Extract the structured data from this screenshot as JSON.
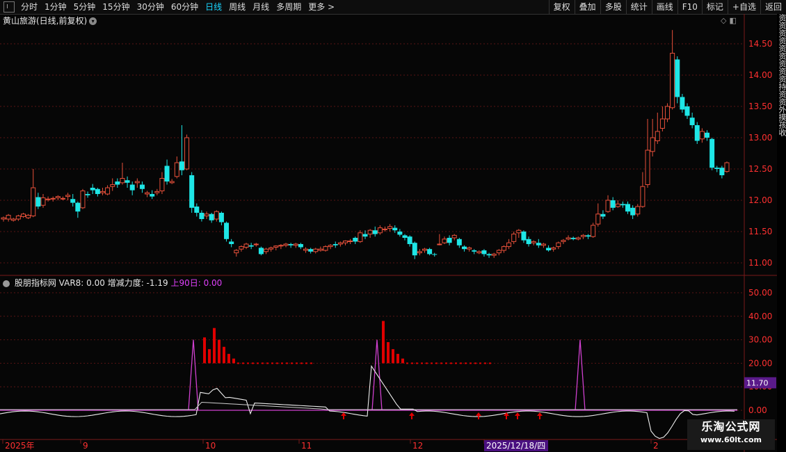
{
  "toolbar": {
    "periods": [
      "分时",
      "1分钟",
      "5分钟",
      "15分钟",
      "30分钟",
      "60分钟",
      "日线",
      "周线",
      "月线",
      "多周期",
      "更多 >"
    ],
    "active_period": "日线",
    "actions": [
      "复权",
      "叠加",
      "多股",
      "统计",
      "画线",
      "F10",
      "标记",
      "+自选",
      "返回"
    ]
  },
  "main_chart": {
    "title": "黄山旅游(日线,前复权)",
    "title_icon": "chevron-down-icon"
  },
  "indicator": {
    "title": "股朋指标网",
    "var8": "VAR8: 0.00",
    "force": "增减力度: -1.19",
    "up90": "上90日: 0.00",
    "current_value_label": "11.70"
  },
  "x_axis": {
    "labels": [
      "2025年",
      "9",
      "10",
      "11",
      "12",
      "2025/12/18/四",
      "2"
    ]
  },
  "side_strip": [
    "资",
    "资",
    "资",
    "资",
    "资",
    "资",
    "资",
    "资",
    "资",
    "持",
    "资",
    "资",
    "外",
    "摸",
    "孩",
    "收"
  ],
  "watermark": {
    "main": "乐淘公式网",
    "url": "www.60lt.com"
  },
  "colors": {
    "up": "#e8503a",
    "down": "#1ee6e6",
    "magenta": "#d040d0",
    "signal": "#e00000",
    "grid": "#5a1414",
    "axis": "#ff3030"
  },
  "chart_data": {
    "type": "candlestick",
    "title": "黄山旅游(日线,前复权)",
    "y_ticks": [
      "14.50",
      "14.00",
      "13.50",
      "13.00",
      "12.50",
      "12.00",
      "11.50",
      "11.00"
    ],
    "ylim": [
      10.88,
      14.8
    ],
    "indicator_ticks": [
      "50.00",
      "40.00",
      "30.00",
      "20.00",
      "10.00",
      "0.00"
    ],
    "indicator_ylim": [
      -10,
      56
    ],
    "candles": [
      [
        11.7,
        11.72,
        11.66,
        11.74
      ],
      [
        11.7,
        11.76,
        11.66,
        11.78
      ],
      [
        11.68,
        11.7,
        11.66,
        11.72
      ],
      [
        11.7,
        11.75,
        11.67,
        11.77
      ],
      [
        11.74,
        11.78,
        11.72,
        11.8
      ],
      [
        11.72,
        11.76,
        11.7,
        11.78
      ],
      [
        11.75,
        12.2,
        11.73,
        12.5
      ],
      [
        12.05,
        11.9,
        11.86,
        12.12
      ],
      [
        11.92,
        12.04,
        11.88,
        12.1
      ],
      [
        12.02,
        12.02,
        11.98,
        12.06
      ],
      [
        12.02,
        12.03,
        11.98,
        12.06
      ],
      [
        12.04,
        12.06,
        12.0,
        12.08
      ],
      [
        12.03,
        12.03,
        12.0,
        12.06
      ],
      [
        12.06,
        12.08,
        12.0,
        12.12
      ],
      [
        12.02,
        11.96,
        11.9,
        12.1
      ],
      [
        11.96,
        11.82,
        11.72,
        11.98
      ],
      [
        11.88,
        12.15,
        11.86,
        12.18
      ],
      [
        12.1,
        12.08,
        12.04,
        12.14
      ],
      [
        12.2,
        12.16,
        12.1,
        12.26
      ],
      [
        12.18,
        12.1,
        12.06,
        12.2
      ],
      [
        12.12,
        12.14,
        12.08,
        12.2
      ],
      [
        12.1,
        12.2,
        12.08,
        12.24
      ],
      [
        12.22,
        12.25,
        12.15,
        12.35
      ],
      [
        12.3,
        12.25,
        12.2,
        12.35
      ],
      [
        12.28,
        12.35,
        12.25,
        12.6
      ],
      [
        12.32,
        12.28,
        12.2,
        12.38
      ],
      [
        12.25,
        12.16,
        12.08,
        12.3
      ],
      [
        12.28,
        12.3,
        12.2,
        12.35
      ],
      [
        12.25,
        12.18,
        12.12,
        12.3
      ],
      [
        12.1,
        12.12,
        12.05,
        12.15
      ],
      [
        12.1,
        12.06,
        12.02,
        12.16
      ],
      [
        12.12,
        12.14,
        12.08,
        12.18
      ],
      [
        12.15,
        12.35,
        12.1,
        12.45
      ],
      [
        12.55,
        12.3,
        12.25,
        12.65
      ],
      [
        12.28,
        12.3,
        12.26,
        12.34
      ],
      [
        12.38,
        12.6,
        12.35,
        12.7
      ],
      [
        12.62,
        12.48,
        12.4,
        13.2
      ],
      [
        12.5,
        13.0,
        12.48,
        13.05
      ],
      [
        12.4,
        11.88,
        11.8,
        12.45
      ],
      [
        11.9,
        11.8,
        11.74,
        11.95
      ],
      [
        11.8,
        11.7,
        11.66,
        11.84
      ],
      [
        11.75,
        11.78,
        11.7,
        11.82
      ],
      [
        11.78,
        11.68,
        11.64,
        11.8
      ],
      [
        11.7,
        11.82,
        11.66,
        11.84
      ],
      [
        11.8,
        11.65,
        11.6,
        11.82
      ],
      [
        11.64,
        11.38,
        11.34,
        11.66
      ],
      [
        11.34,
        11.3,
        11.25,
        11.38
      ],
      [
        11.16,
        11.2,
        11.1,
        11.22
      ],
      [
        11.22,
        11.26,
        11.18,
        11.28
      ],
      [
        11.25,
        11.3,
        11.22,
        11.32
      ],
      [
        11.28,
        11.26,
        11.22,
        11.32
      ],
      [
        11.3,
        11.3,
        11.26,
        11.32
      ],
      [
        11.24,
        11.14,
        11.12,
        11.26
      ],
      [
        11.18,
        11.22,
        11.14,
        11.24
      ],
      [
        11.22,
        11.24,
        11.18,
        11.26
      ],
      [
        11.25,
        11.27,
        11.2,
        11.28
      ],
      [
        11.27,
        11.28,
        11.22,
        11.3
      ],
      [
        11.28,
        11.3,
        11.25,
        11.32
      ],
      [
        11.3,
        11.28,
        11.24,
        11.32
      ],
      [
        11.28,
        11.3,
        11.24,
        11.32
      ],
      [
        11.3,
        11.25,
        11.22,
        11.32
      ],
      [
        11.2,
        11.22,
        11.16,
        11.25
      ],
      [
        11.22,
        11.18,
        11.15,
        11.24
      ],
      [
        11.18,
        11.22,
        11.15,
        11.24
      ],
      [
        11.2,
        11.22,
        11.18,
        11.26
      ],
      [
        11.2,
        11.26,
        11.18,
        11.28
      ],
      [
        11.26,
        11.28,
        11.22,
        11.3
      ],
      [
        11.3,
        11.28,
        11.24,
        11.34
      ],
      [
        11.3,
        11.32,
        11.26,
        11.34
      ],
      [
        11.32,
        11.35,
        11.28,
        11.36
      ],
      [
        11.35,
        11.35,
        11.3,
        11.38
      ],
      [
        11.4,
        11.34,
        11.3,
        11.42
      ],
      [
        11.34,
        11.48,
        11.32,
        11.52
      ],
      [
        11.46,
        11.42,
        11.38,
        11.52
      ],
      [
        11.46,
        11.52,
        11.4,
        11.54
      ],
      [
        11.52,
        11.46,
        11.42,
        11.58
      ],
      [
        11.48,
        11.56,
        11.45,
        11.6
      ],
      [
        11.54,
        11.54,
        11.5,
        11.58
      ],
      [
        11.55,
        11.58,
        11.5,
        11.62
      ],
      [
        11.56,
        11.52,
        11.48,
        11.6
      ],
      [
        11.5,
        11.45,
        11.42,
        11.54
      ],
      [
        11.44,
        11.4,
        11.36,
        11.46
      ],
      [
        11.42,
        11.3,
        11.26,
        11.44
      ],
      [
        11.32,
        11.12,
        11.06,
        11.34
      ],
      [
        11.16,
        11.18,
        11.12,
        11.22
      ],
      [
        11.2,
        11.22,
        11.16,
        11.24
      ],
      [
        11.22,
        11.14,
        11.12,
        11.24
      ],
      [
        11.14,
        11.13,
        11.1,
        11.16
      ],
      [
        11.3,
        11.3,
        11.28,
        11.46
      ],
      [
        11.32,
        11.38,
        11.3,
        11.42
      ],
      [
        11.4,
        11.32,
        11.28,
        11.44
      ],
      [
        11.4,
        11.44,
        11.36,
        11.46
      ],
      [
        11.38,
        11.28,
        11.24,
        11.4
      ],
      [
        11.26,
        11.22,
        11.18,
        11.28
      ],
      [
        11.22,
        11.24,
        11.18,
        11.26
      ],
      [
        11.2,
        11.18,
        11.14,
        11.22
      ],
      [
        11.16,
        11.18,
        11.14,
        11.2
      ],
      [
        11.2,
        11.14,
        11.1,
        11.22
      ],
      [
        11.14,
        11.12,
        11.08,
        11.16
      ],
      [
        11.12,
        11.14,
        11.08,
        11.16
      ],
      [
        11.16,
        11.2,
        11.12,
        11.22
      ],
      [
        11.2,
        11.26,
        11.16,
        11.28
      ],
      [
        11.26,
        11.32,
        11.22,
        11.38
      ],
      [
        11.34,
        11.46,
        11.3,
        11.5
      ],
      [
        11.48,
        11.52,
        11.4,
        11.54
      ],
      [
        11.5,
        11.36,
        11.32,
        11.52
      ],
      [
        11.38,
        11.3,
        11.26,
        11.42
      ],
      [
        11.32,
        11.34,
        11.28,
        11.36
      ],
      [
        11.32,
        11.28,
        11.24,
        11.38
      ],
      [
        11.28,
        11.3,
        11.24,
        11.32
      ],
      [
        11.24,
        11.2,
        11.18,
        11.28
      ],
      [
        11.22,
        11.24,
        11.18,
        11.26
      ],
      [
        11.26,
        11.32,
        11.22,
        11.34
      ],
      [
        11.34,
        11.36,
        11.3,
        11.38
      ],
      [
        11.38,
        11.4,
        11.36,
        11.44
      ],
      [
        11.4,
        11.38,
        11.36,
        11.42
      ],
      [
        11.38,
        11.4,
        11.36,
        11.42
      ],
      [
        11.42,
        11.44,
        11.38,
        11.46
      ],
      [
        11.44,
        11.42,
        11.38,
        11.46
      ],
      [
        11.42,
        11.6,
        11.4,
        11.64
      ],
      [
        11.62,
        11.78,
        11.58,
        11.95
      ],
      [
        11.78,
        11.74,
        11.7,
        11.84
      ],
      [
        11.82,
        12.0,
        11.8,
        12.08
      ],
      [
        12.0,
        11.88,
        11.84,
        12.05
      ],
      [
        11.9,
        11.94,
        11.88,
        12.0
      ],
      [
        11.94,
        11.92,
        11.88,
        11.98
      ],
      [
        11.94,
        11.82,
        11.78,
        11.98
      ],
      [
        11.88,
        11.76,
        11.7,
        11.92
      ],
      [
        11.78,
        11.9,
        11.74,
        11.94
      ],
      [
        11.9,
        12.22,
        11.88,
        12.45
      ],
      [
        12.25,
        12.8,
        12.2,
        13.3
      ],
      [
        12.78,
        13.0,
        12.7,
        13.3
      ],
      [
        12.95,
        13.1,
        12.9,
        13.4
      ],
      [
        13.15,
        13.3,
        13.1,
        13.5
      ],
      [
        13.3,
        13.5,
        13.25,
        13.55
      ],
      [
        13.48,
        14.35,
        13.45,
        14.72
      ],
      [
        14.25,
        13.65,
        13.55,
        14.3
      ],
      [
        13.65,
        13.45,
        13.4,
        13.7
      ],
      [
        13.5,
        13.35,
        13.3,
        13.55
      ],
      [
        13.32,
        13.2,
        13.15,
        13.4
      ],
      [
        13.2,
        12.95,
        12.9,
        13.25
      ],
      [
        12.98,
        13.1,
        12.92,
        13.15
      ],
      [
        13.08,
        13.0,
        12.95,
        13.12
      ],
      [
        12.98,
        12.52,
        12.48,
        13.0
      ],
      [
        12.52,
        12.5,
        12.45,
        12.55
      ],
      [
        12.52,
        12.4,
        12.35,
        12.55
      ],
      [
        12.46,
        12.6,
        12.44,
        12.62
      ]
    ],
    "signal_bars": [
      {
        "x": 278,
        "heights": [
          22,
          12,
          30,
          20,
          14,
          8,
          4,
          2,
          2,
          2,
          2,
          2,
          2,
          2,
          2,
          2,
          2,
          2,
          2,
          2,
          2,
          2,
          2
        ]
      },
      {
        "x": 535,
        "heights": [
          36,
          18,
          12,
          8,
          4,
          2,
          2,
          2,
          2,
          2,
          2,
          2,
          2,
          2,
          2,
          2,
          2,
          2,
          2,
          2,
          2,
          2,
          2
        ]
      }
    ],
    "magenta_spikes": [
      278,
      542,
      834
    ],
    "arrows": [
      494,
      592,
      688,
      728,
      744,
      776
    ]
  }
}
